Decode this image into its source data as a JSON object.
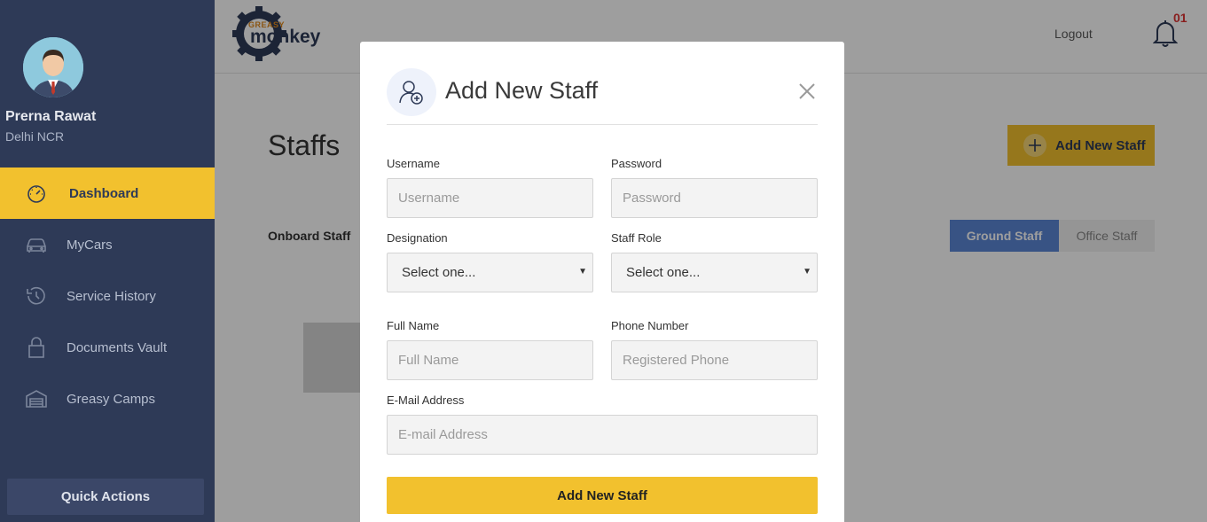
{
  "sidebar": {
    "user_name": "Prerna Rawat",
    "user_location": "Delhi NCR",
    "items": [
      {
        "label": "Dashboard",
        "icon": "speedometer-icon",
        "active": true
      },
      {
        "label": "MyCars",
        "icon": "car-icon"
      },
      {
        "label": "Service History",
        "icon": "history-icon"
      },
      {
        "label": "Documents Vault",
        "icon": "lock-icon"
      },
      {
        "label": "Greasy Camps",
        "icon": "garage-icon"
      }
    ],
    "quick_actions": "Quick Actions"
  },
  "header": {
    "logo_top": "GREASY",
    "logo_main": "monkey",
    "logout": "Logout",
    "notification_count": "01"
  },
  "page": {
    "title": "Staffs",
    "add_button": "Add New Staff",
    "onboard_label": "Onboard Staff",
    "tabs": [
      "Ground Staff",
      "Office Staff"
    ]
  },
  "modal": {
    "title": "Add New Staff",
    "username_label": "Username",
    "username_placeholder": "Username",
    "password_label": "Password",
    "password_placeholder": "Password",
    "designation_label": "Designation",
    "designation_value": "Select one...",
    "role_label": "Staff Role",
    "role_value": "Select one...",
    "fullname_label": "Full Name",
    "fullname_placeholder": "Full Name",
    "phone_label": "Phone Number",
    "phone_placeholder": "Registered Phone",
    "email_label": "E-Mail Address",
    "email_placeholder": "E-mail Address",
    "submit": "Add New Staff"
  },
  "colors": {
    "sidebar_bg": "#2e3a57",
    "accent_yellow": "#f2c12e",
    "tab_blue": "#5b86d6",
    "notification_red": "#d33333"
  }
}
